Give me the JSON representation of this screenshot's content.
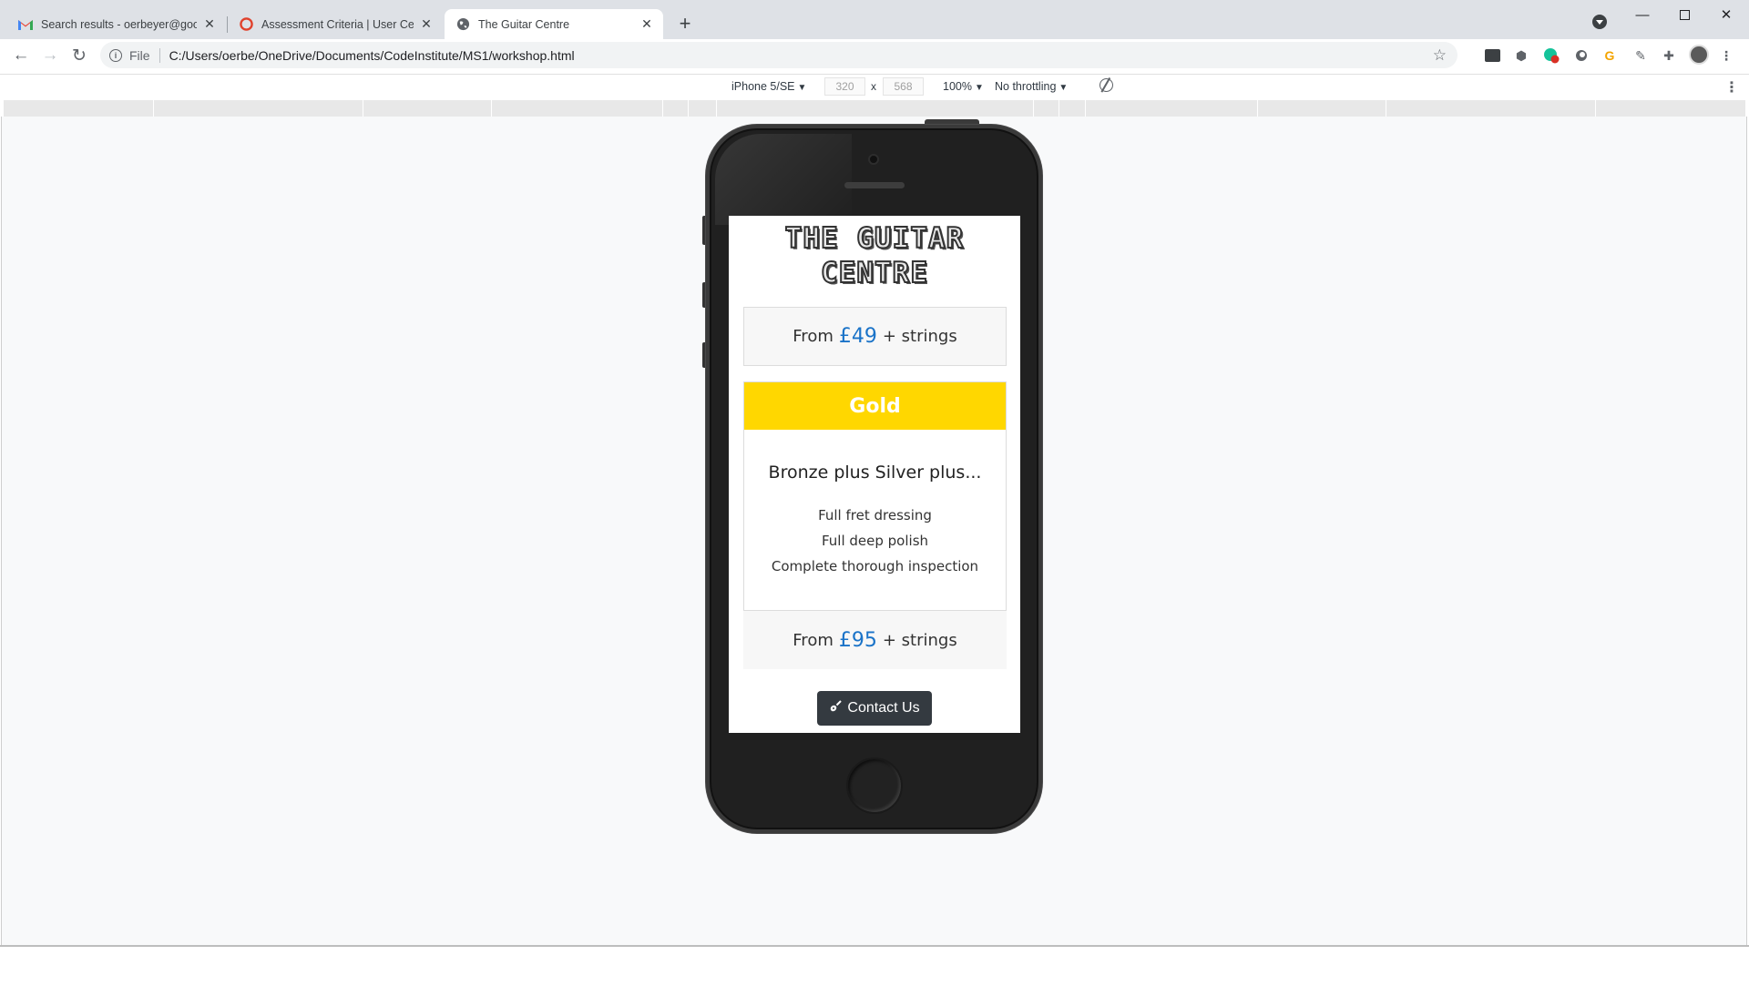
{
  "browser": {
    "tabs": [
      {
        "title": "Search results - oerbeyer@googl",
        "favicon": "gmail-icon"
      },
      {
        "title": "Assessment Criteria | User Centric",
        "favicon": "opera-icon"
      },
      {
        "title": "The Guitar Centre",
        "favicon": "globe-icon"
      }
    ],
    "new_tab_label": "+",
    "url_chip": "File",
    "url": "C:/Users/oerbe/OneDrive/Documents/CodeInstitute/MS1/workshop.html"
  },
  "device_toolbar": {
    "device": "iPhone 5/SE",
    "width": "320",
    "height": "568",
    "times": "x",
    "zoom": "100%",
    "throttling": "No throttling"
  },
  "page": {
    "title": "THE GUITAR CENTRE",
    "top_price": {
      "prefix": "From",
      "amount": "£49",
      "suffix": "+ strings"
    },
    "card": {
      "heading": "Gold",
      "subtitle": "Bronze plus Silver plus...",
      "features": [
        "Full fret dressing",
        "Full deep polish",
        "Complete thorough inspection"
      ],
      "price": {
        "prefix": "From",
        "amount": "£95",
        "suffix": "+ strings"
      }
    },
    "contact_button": "Contact Us"
  },
  "colors": {
    "gold": "#ffd700",
    "price_blue": "#1a73c8",
    "button_dark": "#343a40"
  }
}
